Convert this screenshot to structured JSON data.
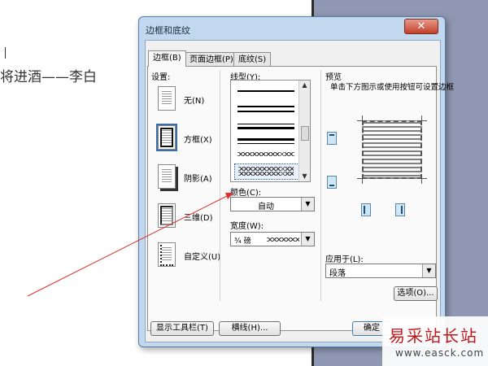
{
  "document": {
    "title_text": "将进酒——李白"
  },
  "dialog": {
    "title": "边框和底纹",
    "close_glyph": "✕",
    "tabs": [
      {
        "label": "边框(B)",
        "active": true
      },
      {
        "label": "页面边框(P)",
        "active": false
      },
      {
        "label": "底纹(S)",
        "active": false
      }
    ],
    "settings": {
      "heading": "设置:",
      "items": [
        {
          "label": "无(N)"
        },
        {
          "label": "方框(X)",
          "selected": true
        },
        {
          "label": "阴影(A)"
        },
        {
          "label": "三维(D)"
        },
        {
          "label": "自定义(U)"
        }
      ]
    },
    "style": {
      "heading": "线型(Y):",
      "selected_style": "wavy-double"
    },
    "color": {
      "label": "颜色(C):",
      "value": "自动"
    },
    "width": {
      "label": "宽度(W):",
      "value": "¾ 磅"
    },
    "preview": {
      "heading": "预览",
      "hint": "单击下方图示或使用按钮可设置边框"
    },
    "apply_to": {
      "label": "应用于(L):",
      "value": "段落"
    },
    "buttons": {
      "options": "选项(O)...",
      "show_toolbar": "显示工具栏(T)",
      "horizontal_line": "横线(H)...",
      "ok": "确定"
    }
  },
  "watermark": {
    "logo_text": "易采站长站",
    "url": "www.easck.com"
  },
  "colors": {
    "dialog_frame": "#c2d8ef",
    "annotation_arrow": "#e03030",
    "watermark_red": "#c0171b"
  }
}
